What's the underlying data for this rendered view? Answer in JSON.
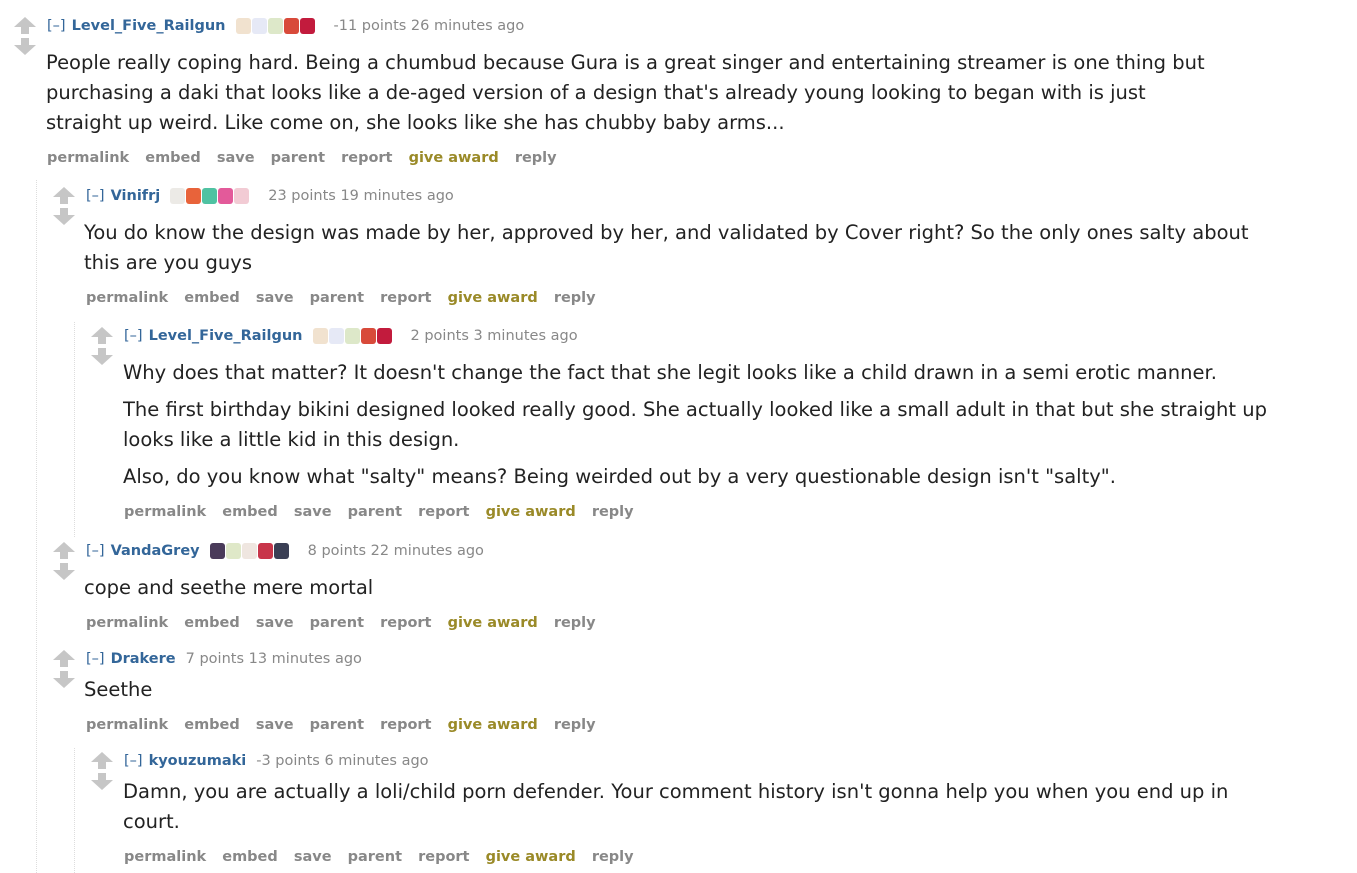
{
  "colors": {
    "link": "#336699",
    "meta": "#888888",
    "award": "#9a8a28",
    "arrow": "#c6c6c6"
  },
  "actions": {
    "permalink": "permalink",
    "embed": "embed",
    "save": "save",
    "parent": "parent",
    "report": "report",
    "give_award": "give award",
    "reply": "reply"
  },
  "comments": [
    {
      "toggle": "[–]",
      "author": "Level_Five_Railgun",
      "score_time": "-11 points 26 minutes ago",
      "paragraphs": [
        "People really coping hard. Being a chumbud because Gura is a great singer and entertaining streamer is one thing but",
        "purchasing a daki that looks like a de-aged version of a design that's already young looking to began with is just",
        "straight up weird. Like come on, she looks like she has chubby baby arms..."
      ]
    },
    {
      "toggle": "[–]",
      "author": "Vinifrj",
      "score_time": "23 points 19 minutes ago",
      "paragraphs": [
        "You do know the design was made by her, approved by her, and validated by Cover right? So the only ones salty about",
        "this are you guys"
      ]
    },
    {
      "toggle": "[–]",
      "author": "Level_Five_Railgun",
      "score_time": "2 points 3 minutes ago",
      "paragraphs": [
        "Why does that matter? It doesn't change the fact that she legit looks like a child drawn in a semi erotic manner.",
        "The first birthday bikini designed looked really good. She actually looked like a small adult in that but she straight up",
        "looks like a little kid in this design.",
        "Also, do you know what \"salty\" means? Being weirded out by a very questionable design isn't \"salty\"."
      ]
    },
    {
      "toggle": "[–]",
      "author": "VandaGrey",
      "score_time": "8 points 22 minutes ago",
      "paragraphs": [
        "cope and seethe mere mortal"
      ]
    },
    {
      "toggle": "[–]",
      "author": "Drakere",
      "score_time": "7 points 13 minutes ago",
      "paragraphs": [
        "Seethe"
      ]
    },
    {
      "toggle": "[–]",
      "author": "kyouzumaki",
      "score_time": "-3 points 6 minutes ago",
      "paragraphs": [
        "Damn, you are actually a loli/child porn defender. Your comment history isn't gonna help you when you end up in",
        "court."
      ]
    }
  ]
}
